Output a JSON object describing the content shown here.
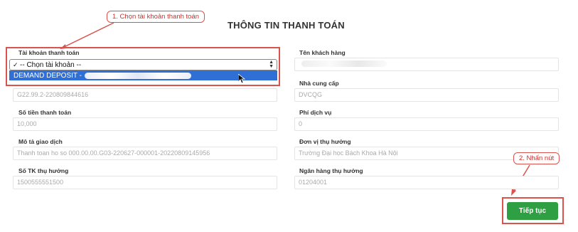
{
  "page": {
    "title": "THÔNG TIN THANH TOÁN"
  },
  "annotations": {
    "step1": "1. Chọn tài khoản thanh toán",
    "step2": "2. Nhấn nút",
    "color": "#d9534f"
  },
  "account": {
    "label": "Tài khoản thanh toán",
    "selected": "-- Chọn tài khoản --",
    "highlighted_option": "DEMAND DEPOSIT -"
  },
  "left_fields": [
    {
      "label": "",
      "value": "G22.99.2-220809844616"
    },
    {
      "label": "Số tiền thanh toán",
      "value": "10,000"
    },
    {
      "label": "Mô tả giao dịch",
      "value": "Thanh toan ho so 000.00.00.G03-220627-000001-20220809145956"
    },
    {
      "label": "Số TK thụ hưởng",
      "value": "1500555551500"
    }
  ],
  "right_fields": [
    {
      "label": "Tên khách hàng",
      "value": ""
    },
    {
      "label": "Nhà cung cấp",
      "value": "DVCQG"
    },
    {
      "label": "Phí dịch vụ",
      "value": "0"
    },
    {
      "label": "Đơn vị thụ hưởng",
      "value": "Trường Đại học Bách Khoa Hà Nội"
    },
    {
      "label": "Ngân hàng thụ hưởng",
      "value": "01204001"
    }
  ],
  "actions": {
    "continue_label": "Tiếp tục",
    "button_color": "#2ea043"
  }
}
